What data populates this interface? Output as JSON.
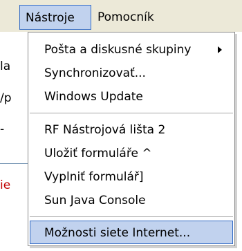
{
  "menubar": {
    "items": [
      {
        "label": "Nástroje"
      },
      {
        "label": "Pomocník"
      }
    ]
  },
  "background": {
    "fragments": [
      "la",
      "/p",
      "-",
      "",
      "ie"
    ]
  },
  "menu": {
    "items": [
      {
        "label": "Pošta a diskusné skupiny",
        "has_submenu": true
      },
      {
        "label": "Synchronizovať..."
      },
      {
        "label": "Windows Update"
      },
      {
        "label": "RF Nástrojová lišta 2"
      },
      {
        "label": "Uložiť formuláře ^"
      },
      {
        "label": "Vyplniť formulář]"
      },
      {
        "label": "Sun Java Console"
      },
      {
        "label": "Možnosti siete Internet..."
      }
    ]
  },
  "colors": {
    "menubar_bg": "#ece9d8",
    "highlight_bg": "#c1d2ee",
    "highlight_border": "#316ac5"
  }
}
